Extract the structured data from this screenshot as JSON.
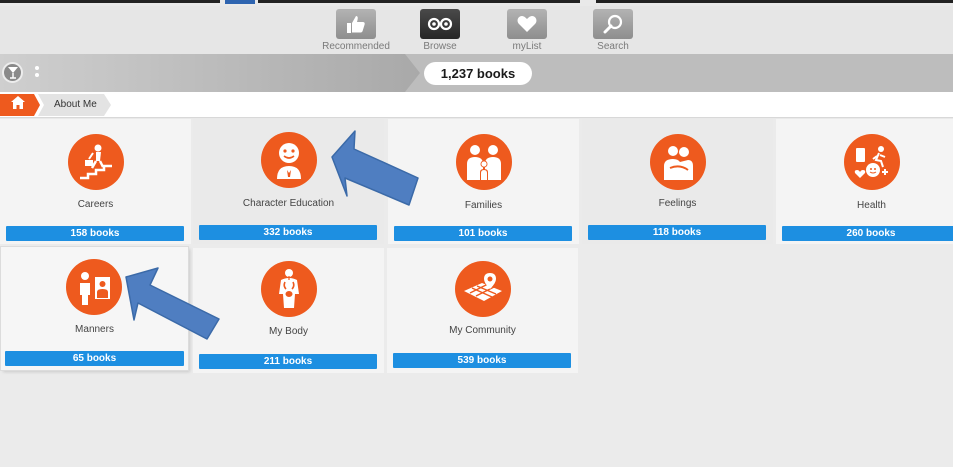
{
  "topnav": {
    "items": [
      {
        "label": "Recommended",
        "icon": "thumbs-up-icon"
      },
      {
        "label": "Browse",
        "icon": "glasses-icon"
      },
      {
        "label": "myList",
        "icon": "heart-icon"
      },
      {
        "label": "Search",
        "icon": "magnifier-icon"
      }
    ],
    "active": "Browse"
  },
  "toolbar": {
    "book_count": "1,237 books"
  },
  "breadcrumb": {
    "current": "About Me"
  },
  "categories": [
    {
      "label": "Careers",
      "count": "158 books",
      "icon": "careers-icon"
    },
    {
      "label": "Character Education",
      "count": "332 books",
      "icon": "character-education-icon"
    },
    {
      "label": "Families",
      "count": "101 books",
      "icon": "families-icon"
    },
    {
      "label": "Feelings",
      "count": "118 books",
      "icon": "feelings-icon"
    },
    {
      "label": "Health",
      "count": "260 books",
      "icon": "health-icon"
    },
    {
      "label": "Manners",
      "count": "65 books",
      "icon": "manners-icon"
    },
    {
      "label": "My Body",
      "count": "211 books",
      "icon": "my-body-icon"
    },
    {
      "label": "My Community",
      "count": "539 books",
      "icon": "my-community-icon"
    }
  ],
  "colors": {
    "accent": "#ee5a1e",
    "count_bar": "#1d8fe1",
    "annotation_arrow": "#4f7ec1"
  }
}
